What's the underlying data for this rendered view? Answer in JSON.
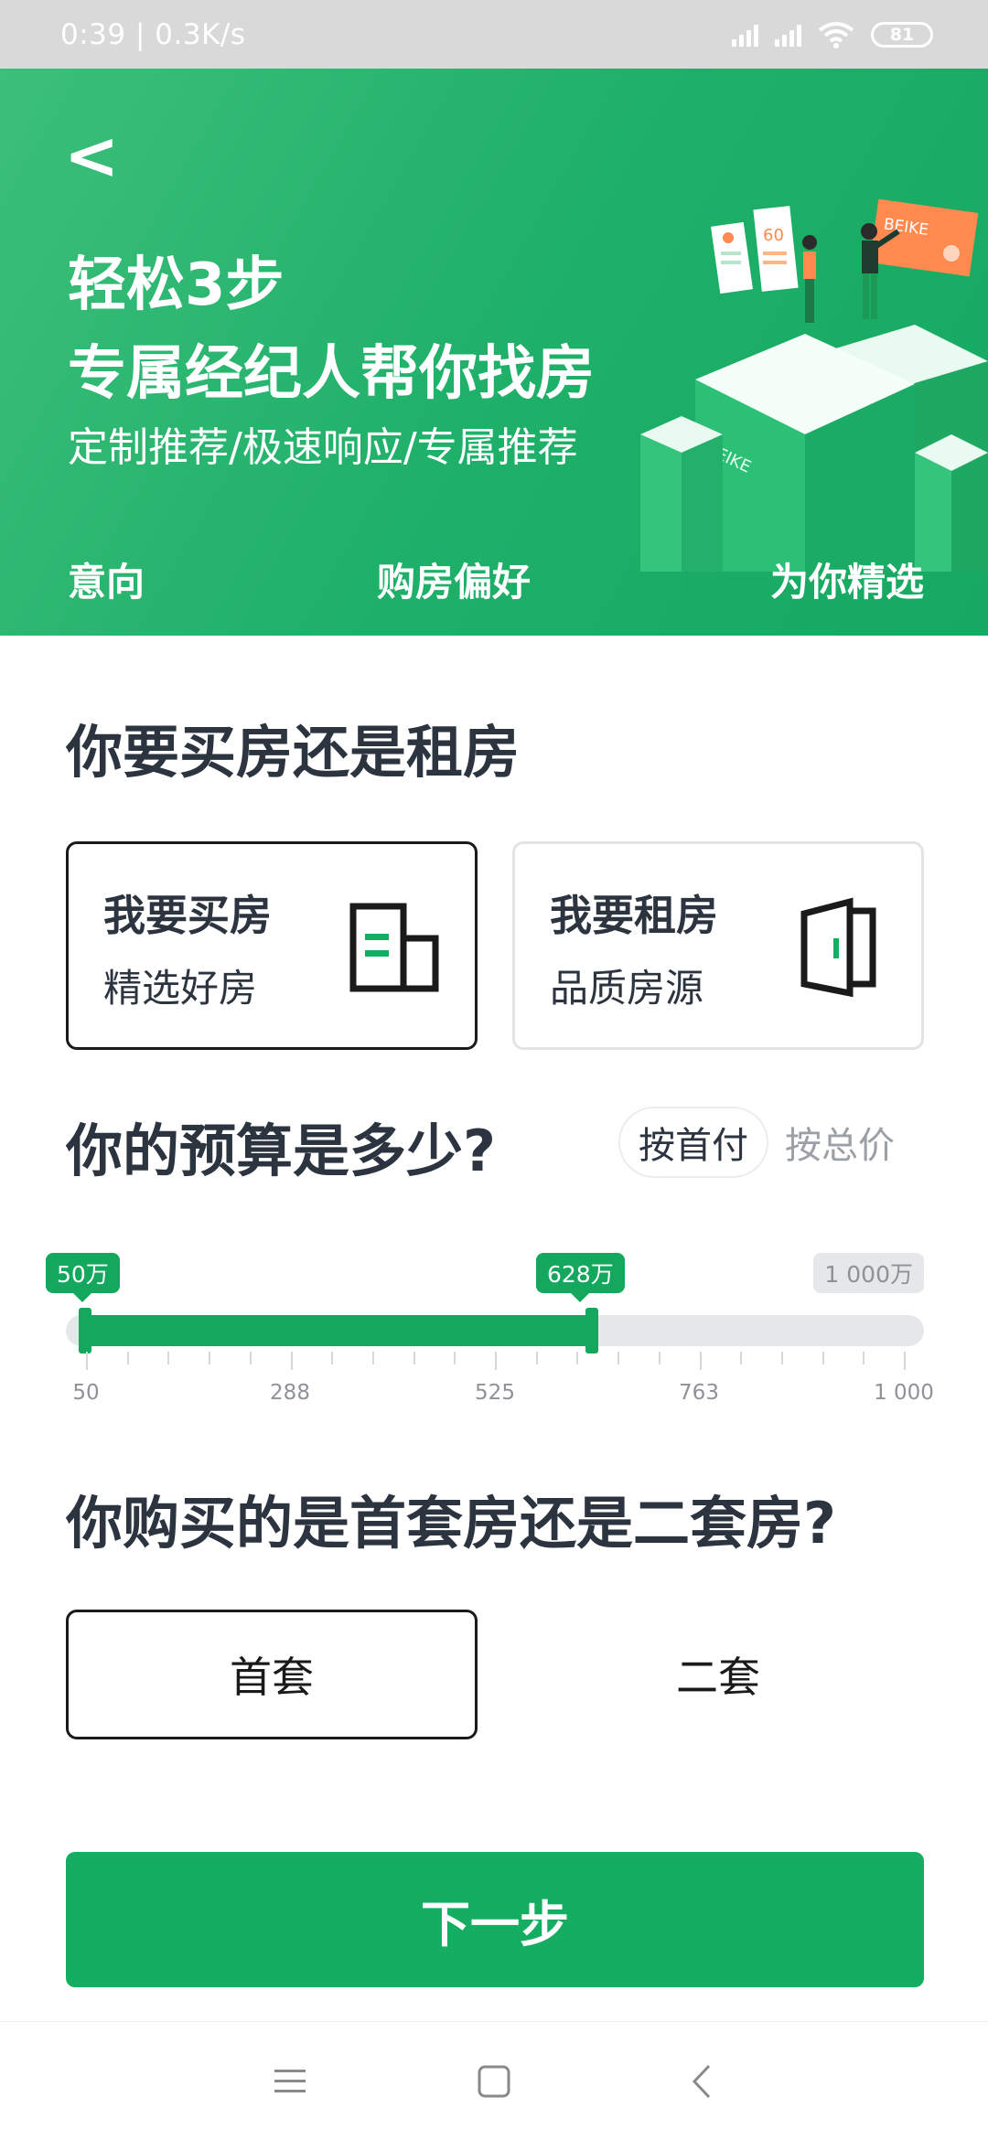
{
  "status_bar": {
    "time": "0:39",
    "net_speed": "0.3K/s",
    "battery": "81",
    "icons": [
      "signal-icon",
      "signal-icon",
      "wifi-icon",
      "battery-icon"
    ]
  },
  "header": {
    "back_label": "<",
    "title_line1": "轻松3步",
    "title_line2": "专属经纪人帮你找房",
    "subtitle": "定制推荐/极速响应/专属推荐",
    "steps": [
      "意向",
      "购房偏好",
      "为你精选"
    ],
    "illustration_texts": [
      "60",
      "BEIKE",
      "BEIKE"
    ]
  },
  "buy_or_rent": {
    "question": "你要买房还是租房",
    "options": [
      {
        "title": "我要买房",
        "desc": "精选好房",
        "icon": "building-icon",
        "selected": true
      },
      {
        "title": "我要租房",
        "desc": "品质房源",
        "icon": "door-icon",
        "selected": false
      }
    ]
  },
  "budget": {
    "question": "你的预算是多少?",
    "modes": [
      "按首付",
      "按总价"
    ],
    "active_mode": "按首付",
    "min_label": "50万",
    "max_label": "628万",
    "end_label": "1 000万",
    "range": {
      "min": 50,
      "max": 1000,
      "selected_low": 50,
      "selected_high": 628
    },
    "tick_labels": [
      "50",
      "288",
      "525",
      "763",
      "1 000"
    ]
  },
  "house_type": {
    "question": "你购买的是首套房还是二套房?",
    "options": [
      "首套",
      "二套"
    ],
    "selected": "首套"
  },
  "next_button": "下一步",
  "nav": [
    "menu-icon",
    "home-icon",
    "back-icon"
  ],
  "colors": {
    "brand_green": "#14ad62",
    "text_dark": "#2c3440",
    "muted": "#9aa0a6"
  }
}
